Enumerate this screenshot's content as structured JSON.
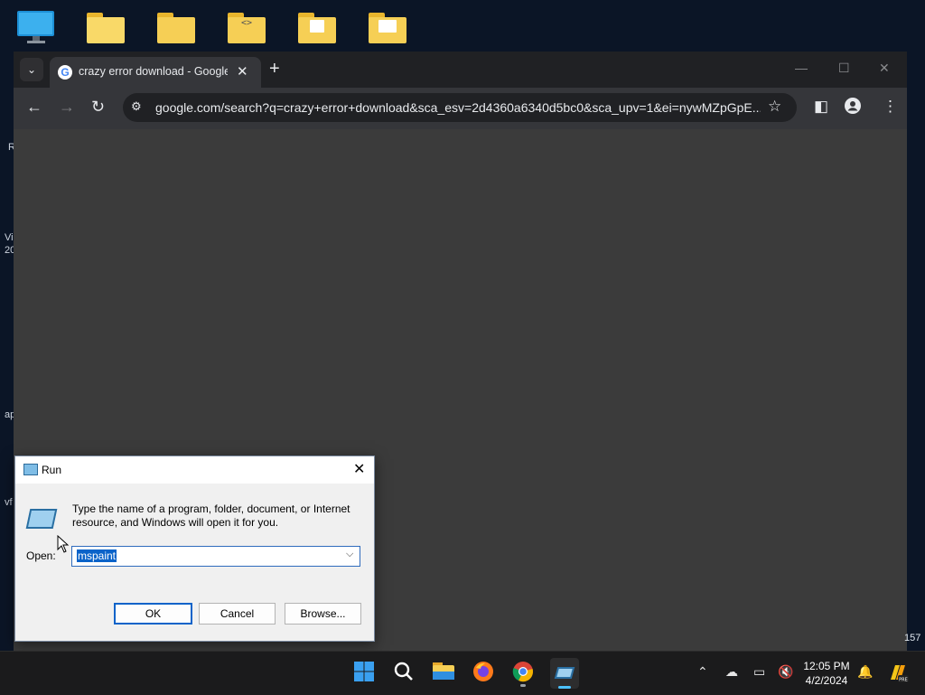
{
  "desktop": {
    "left_labels": [
      "R",
      "Vi",
      "20",
      "ap",
      "vf"
    ],
    "corner_text": "157",
    "icons": [
      "monitor-icon",
      "folder-icon",
      "folder-icon",
      "folder-icon",
      "folder-icon",
      "folder-icon"
    ]
  },
  "browser": {
    "tab": {
      "title": "crazy error download - Google Search",
      "favicon": "G"
    },
    "new_tab": "+",
    "address": "google.com/search?q=crazy+error+download&sca_esv=2d4360a6340d5bc0&sca_upv=1&ei=nywMZpGpE...",
    "window_controls": {
      "minimize": "—",
      "maximize": "☐",
      "close": "✕"
    }
  },
  "run_dialog": {
    "title": "Run",
    "description": "Type the name of a program, folder, document, or Internet resource, and Windows will open it for you.",
    "open_label": "Open:",
    "input_value": "mspaint",
    "buttons": {
      "ok": "OK",
      "cancel": "Cancel",
      "browse": "Browse..."
    }
  },
  "taskbar": {
    "time": "12:05 PM",
    "date": "4/2/2024",
    "apps": [
      "start",
      "search",
      "file-explorer",
      "firefox",
      "chrome",
      "run"
    ]
  },
  "colors": {
    "accent": "#0a63c9",
    "chrome_dark": "#202124",
    "taskbar": "#1b1b1c"
  }
}
